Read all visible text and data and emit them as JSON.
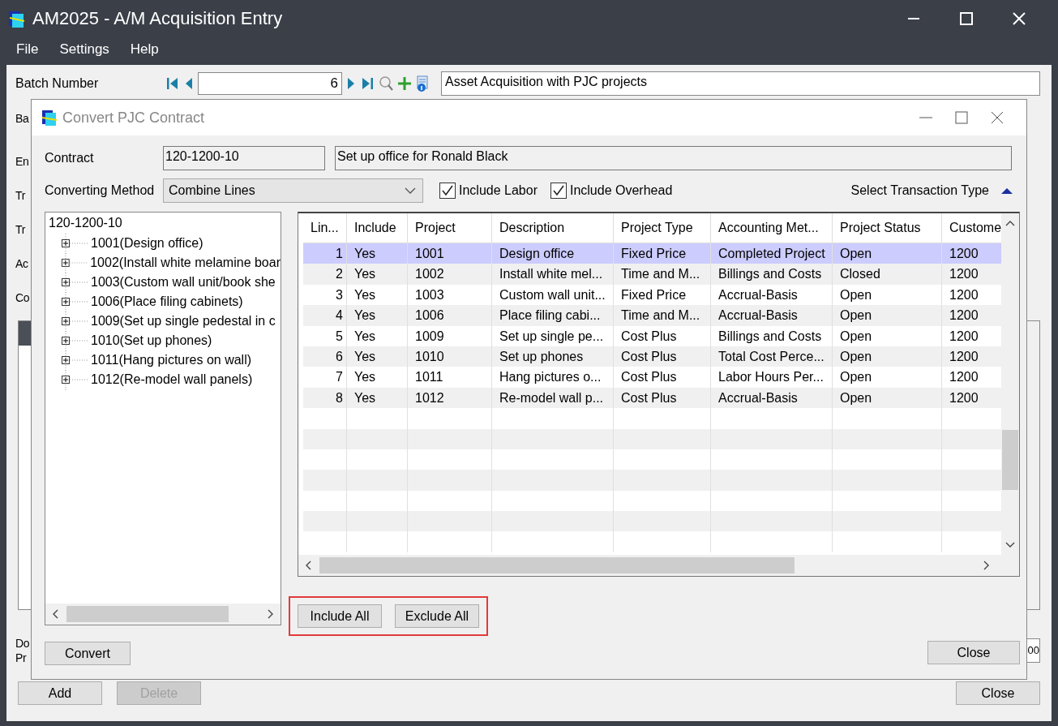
{
  "window": {
    "title": "AM2025 - A/M Acquisition Entry"
  },
  "menu": [
    "File",
    "Settings",
    "Help"
  ],
  "batch": {
    "label": "Batch Number",
    "number": "6",
    "description": "Asset Acquisition with PJC projects"
  },
  "background_labels": [
    "Ba",
    "En",
    "Tr",
    "Tr",
    "Ac",
    "Co"
  ],
  "background_lower_labels": [
    "Do",
    "Pr"
  ],
  "background_field_value": "00",
  "buttons": [
    {
      "label": "Add",
      "disabled": false
    },
    {
      "label": "Delete",
      "disabled": true
    }
  ],
  "close_button": "Close",
  "dialog": {
    "title": "Convert PJC Contract",
    "contract_label": "Contract",
    "contract": "120-1200-10",
    "contract_description": "Set up office for Ronald Black",
    "method_label": "Converting Method",
    "method": "Combine Lines",
    "options": [
      {
        "label": "Include Labor",
        "checked": true
      },
      {
        "label": "Include Overhead",
        "checked": true
      }
    ],
    "transaction_type": {
      "label": "Select Transaction Type",
      "expanded": true
    },
    "tree": {
      "label": "120-1200-10",
      "children": [
        {
          "label": "1001(Design office)",
          "expanded": false
        },
        {
          "label": "1002(Install white melamine boar",
          "expanded": false
        },
        {
          "label": "1003(Custom wall unit/book she",
          "expanded": false
        },
        {
          "label": "1006(Place filing cabinets)",
          "expanded": false
        },
        {
          "label": "1009(Set up single pedestal in c",
          "expanded": false
        },
        {
          "label": "1010(Set up phones)",
          "expanded": false
        },
        {
          "label": "1011(Hang pictures on wall)",
          "expanded": false
        },
        {
          "label": "1012(Re-model wall panels)",
          "expanded": false
        }
      ]
    },
    "table": {
      "columns": [
        "Lin...",
        "Include",
        "Project",
        "Description",
        "Project Type",
        "Accounting Met...",
        "Project Status",
        "Custome"
      ],
      "rows": [
        {
          "cells": [
            "1",
            "Yes",
            "1001",
            "Design office",
            "Fixed Price",
            "Completed Project",
            "Open",
            "1200"
          ],
          "selected": true
        },
        {
          "cells": [
            "2",
            "Yes",
            "1002",
            "Install white mel...",
            "Time and M...",
            "Billings and Costs",
            "Closed",
            "1200"
          ],
          "selected": false
        },
        {
          "cells": [
            "3",
            "Yes",
            "1003",
            "Custom wall unit...",
            "Fixed Price",
            "Accrual-Basis",
            "Open",
            "1200"
          ],
          "selected": false
        },
        {
          "cells": [
            "4",
            "Yes",
            "1006",
            "Place filing cabi...",
            "Time and M...",
            "Accrual-Basis",
            "Open",
            "1200"
          ],
          "selected": false
        },
        {
          "cells": [
            "5",
            "Yes",
            "1009",
            "Set up single pe...",
            "Cost Plus",
            "Billings and Costs",
            "Open",
            "1200"
          ],
          "selected": false
        },
        {
          "cells": [
            "6",
            "Yes",
            "1010",
            "Set up phones",
            "Cost Plus",
            "Total Cost Perce...",
            "Open",
            "1200"
          ],
          "selected": false
        },
        {
          "cells": [
            "7",
            "Yes",
            "1011",
            "Hang pictures o...",
            "Cost Plus",
            "Labor Hours Per...",
            "Open",
            "1200"
          ],
          "selected": false
        },
        {
          "cells": [
            "8",
            "Yes",
            "1012",
            "Re-model wall p...",
            "Cost Plus",
            "Accrual-Basis",
            "Open",
            "1200"
          ],
          "selected": false
        }
      ]
    },
    "include_all": "Include All",
    "exclude_all": "Exclude All",
    "convert": "Convert",
    "close": "Close"
  }
}
